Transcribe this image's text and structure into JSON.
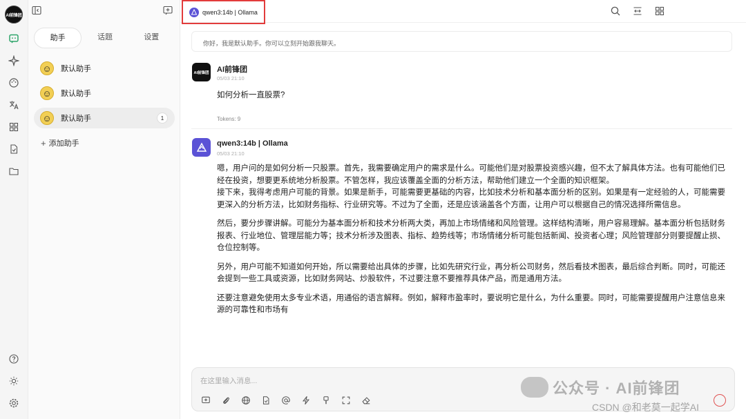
{
  "rail": {
    "avatar_text": "AI前锋团",
    "icons": [
      "chat-icon",
      "sparkle-icon",
      "palette-icon",
      "translate-icon",
      "apps-icon",
      "files-icon",
      "folder-icon",
      "help-icon",
      "theme-icon",
      "settings-icon"
    ]
  },
  "sidebar": {
    "tabs": [
      "助手",
      "话题",
      "设置"
    ],
    "assistants": [
      {
        "name": "默认助手",
        "badge": ""
      },
      {
        "name": "默认助手",
        "badge": ""
      },
      {
        "name": "默认助手",
        "badge": "1"
      }
    ],
    "add_label": "添加助手"
  },
  "topbar": {
    "model": "qwen3:14b | Ollama"
  },
  "chat": {
    "greeting": "你好，我是默认助手。你可以立刻开始跟我聊天。",
    "user": {
      "name": "AI前锋团",
      "time": "05/03 21:10",
      "text": "如何分析一直股票?",
      "tokens": "Tokens: 9"
    },
    "bot": {
      "name": "qwen3:14b | Ollama",
      "time": "05/03 21:10",
      "paragraphs": [
        "嗯，用户问的是如何分析一只股票。首先，我需要确定用户的需求是什么。可能他们是对股票投资感兴趣，但不太了解具体方法。也有可能他们已经在投资，想要更系统地分析股票。不管怎样，我应该覆盖全面的分析方法，帮助他们建立一个全面的知识框架。",
        "接下来，我得考虑用户可能的背景。如果是新手，可能需要更基础的内容，比如技术分析和基本面分析的区别。如果是有一定经验的人，可能需要更深入的分析方法，比如财务指标、行业研究等。不过为了全面，还是应该涵盖各个方面，让用户可以根据自己的情况选择所需信息。",
        "然后，要分步骤讲解。可能分为基本面分析和技术分析两大类，再加上市场情绪和风险管理。这样结构清晰，用户容易理解。基本面分析包括财务报表、行业地位、管理层能力等；技术分析涉及图表、指标、趋势线等；市场情绪分析可能包括新闻、投资者心理；风险管理部分则要提醒止损、仓位控制等。",
        "另外，用户可能不知道如何开始，所以需要给出具体的步骤，比如先研究行业，再分析公司财务，然后看技术图表，最后综合判断。同时，可能还会提到一些工具或资源，比如财务网站、炒股软件，不过要注意不要推荐具体产品，而是通用方法。",
        "还要注意避免使用太多专业术语，用通俗的语言解释。例如，解释市盈率时，要说明它是什么，为什么重要。同时，可能需要提醒用户注意信息来源的可靠性和市场有"
      ]
    }
  },
  "input": {
    "placeholder": "在这里输入消息..."
  },
  "watermark": {
    "main": "公众号 · AI前锋团",
    "sub": "CSDN @和老莫一起学AI"
  },
  "colors": {
    "accent": "#5b52d6",
    "highlight_border": "#e23b3b"
  }
}
